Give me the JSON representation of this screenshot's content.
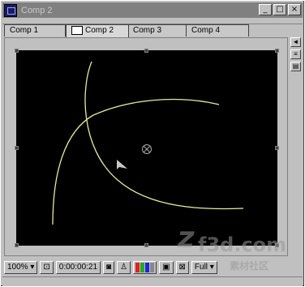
{
  "window": {
    "title": "Comp 2"
  },
  "titlebar_buttons": [
    "_",
    "□",
    "×"
  ],
  "tabs": [
    {
      "label": "Comp 1"
    },
    {
      "label": "Comp 2"
    },
    {
      "label": "Comp 3"
    },
    {
      "label": "Comp 4"
    }
  ],
  "statusbar": {
    "zoom": "100%",
    "timecode": "0:00:00:21",
    "resolution": "Full"
  },
  "watermark": {
    "logo": "z",
    "site": "f3d.com",
    "sub": "素材社区"
  },
  "colors": {
    "canvas": "#000000",
    "path": "#e8e8a0",
    "window": "#c0c0c0",
    "titlebar": "#808080"
  }
}
